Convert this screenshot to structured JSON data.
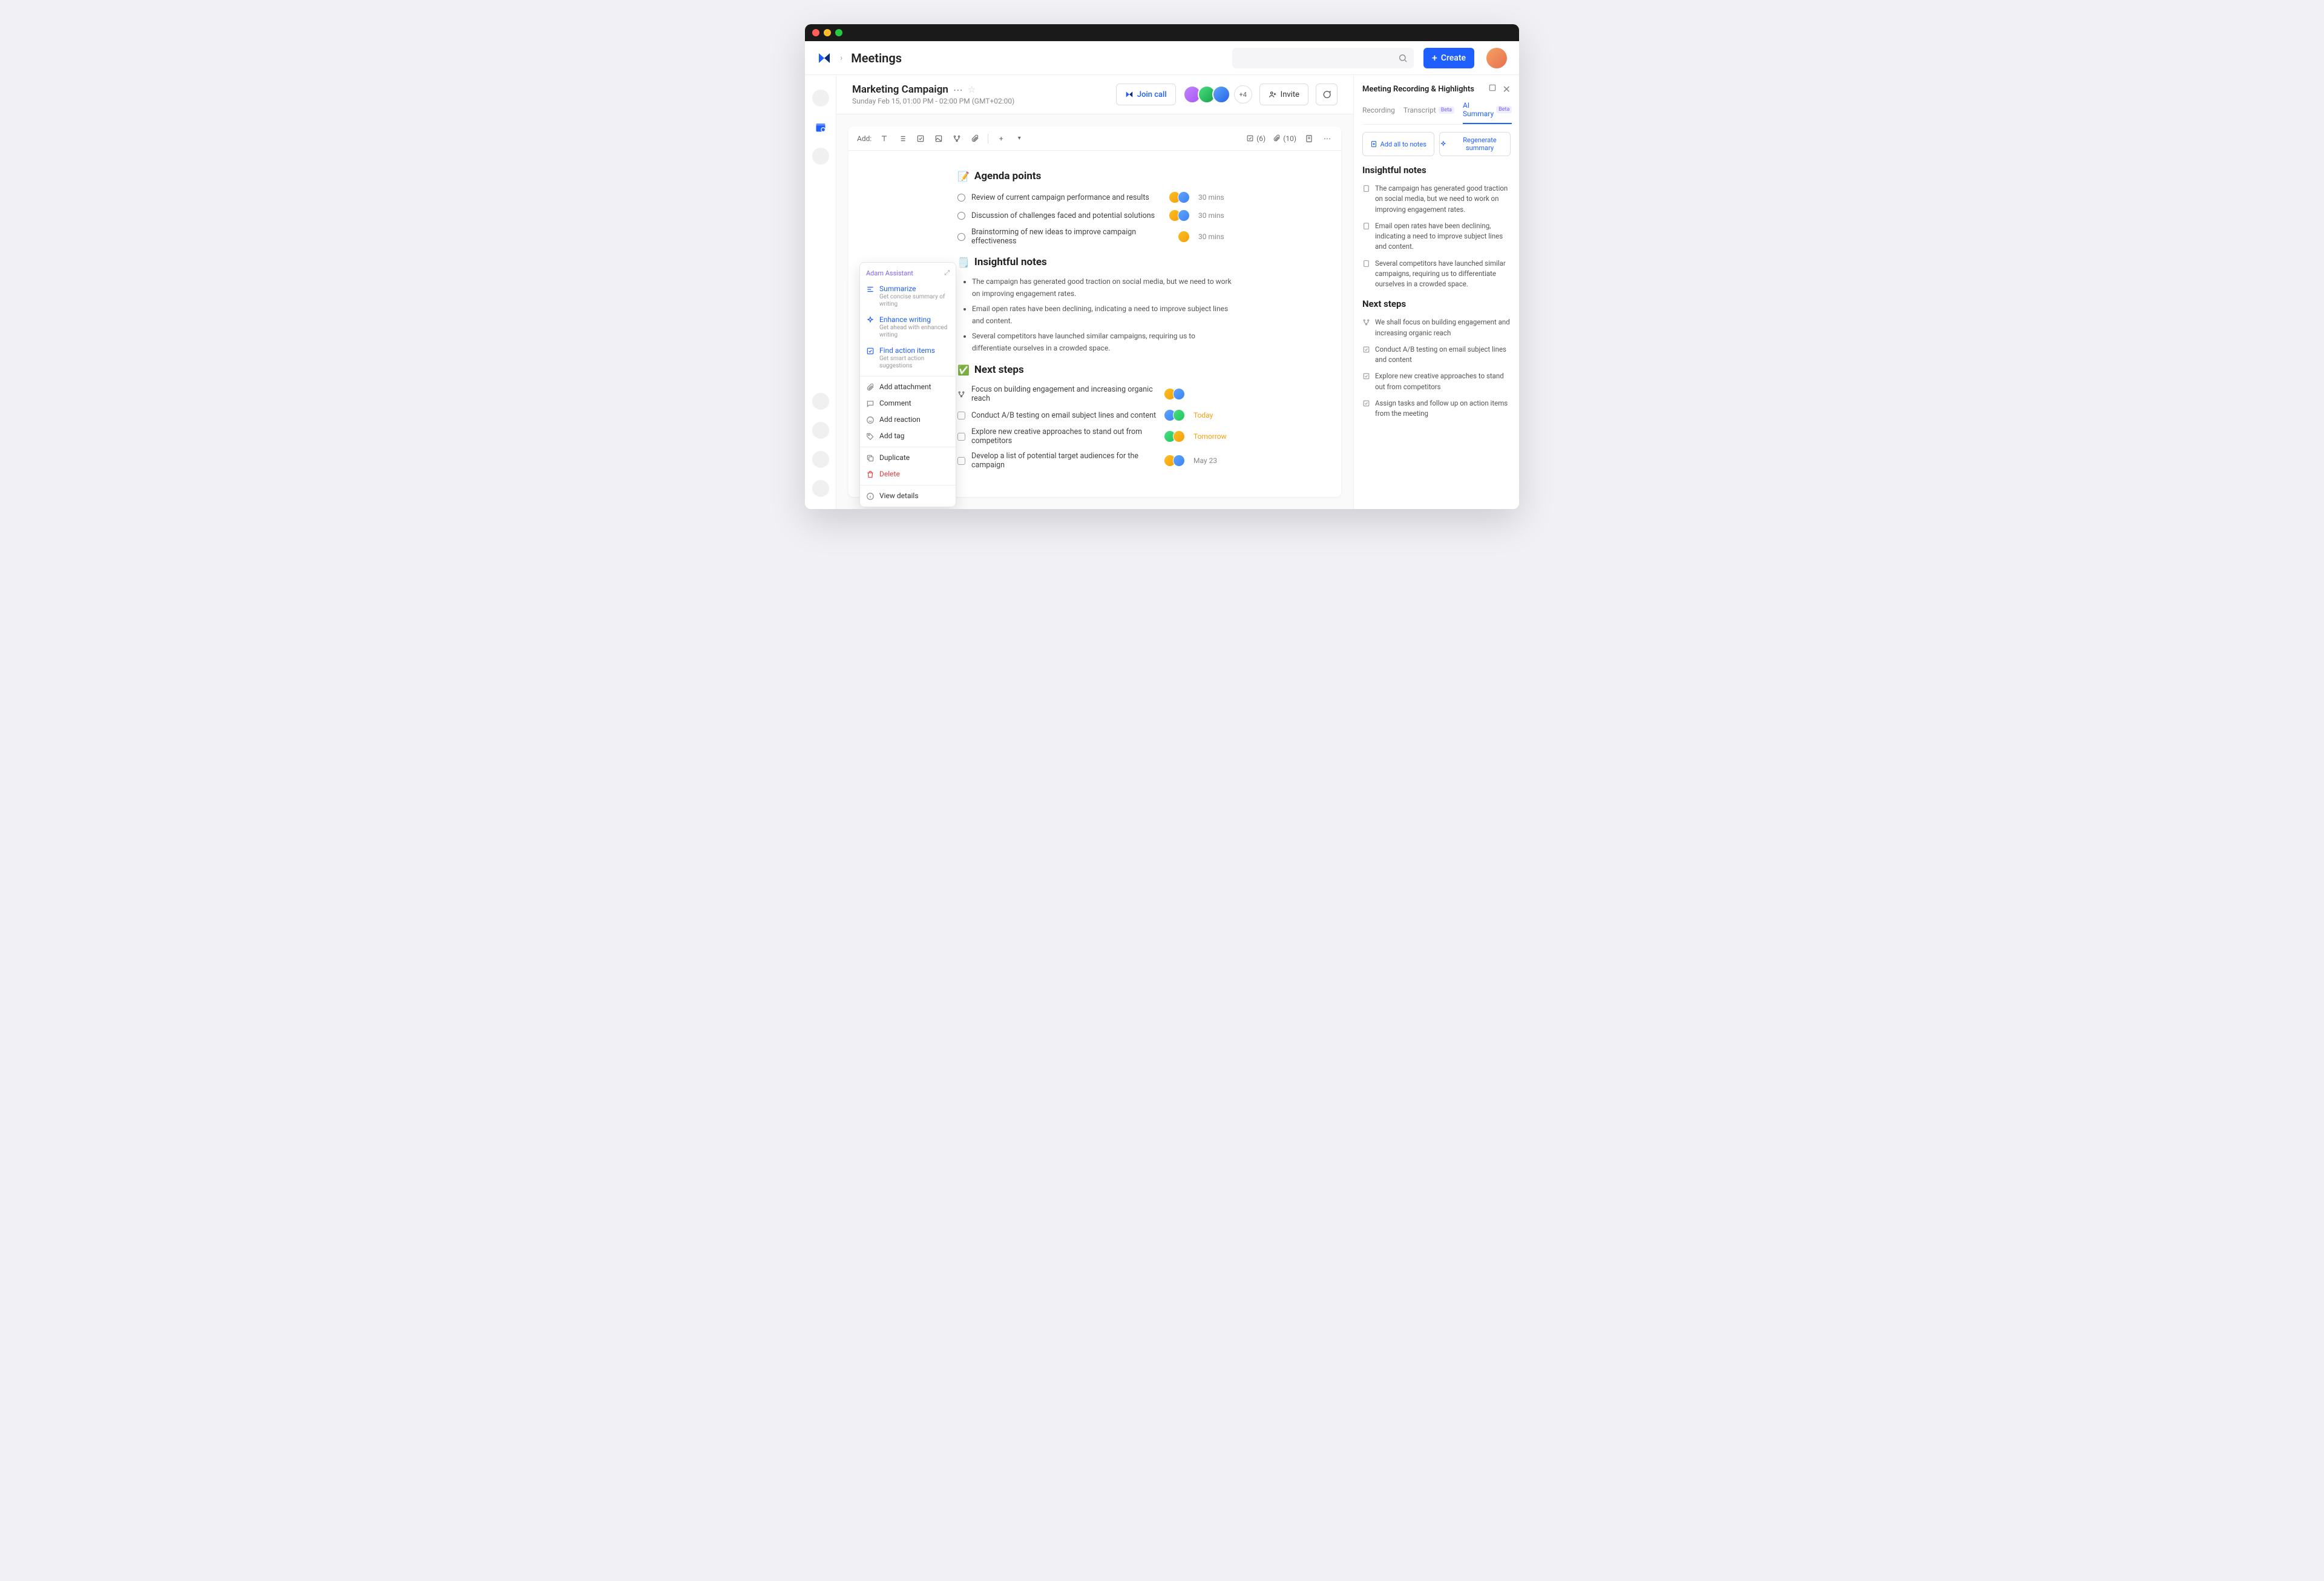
{
  "topbar": {
    "breadcrumb_title": "Meetings",
    "create_label": "Create"
  },
  "page": {
    "title": "Marketing Campaign",
    "subtitle": "Sunday Feb 15, 01:00 PM - 02:00 PM (GMT+02:00)",
    "join_call": "Join call",
    "invite": "Invite",
    "more_avatars": "+4"
  },
  "toolbar": {
    "add_label": "Add:",
    "check_count": "(6)",
    "attach_count": "(10)"
  },
  "sections": {
    "agenda_title": "Agenda points",
    "notes_title": "Insightful notes",
    "next_title": "Next steps"
  },
  "agenda": [
    {
      "text": "Review of current campaign performance and results",
      "duration": "30 mins"
    },
    {
      "text": "Discussion of challenges faced and potential solutions",
      "duration": "30 mins"
    },
    {
      "text": "Brainstorming of new ideas to improve campaign effectiveness",
      "duration": "30 mins"
    }
  ],
  "notes": [
    "The campaign has generated good traction on social media, but we need to work on improving engagement rates.",
    "Email open rates have been declining, indicating a need to improve subject lines and content.",
    "Several competitors have launched similar campaigns, requiring us to differentiate ourselves in a crowded space."
  ],
  "next_steps": [
    {
      "type": "branch",
      "text": "Focus on building engagement and increasing organic reach",
      "due": "",
      "due_class": ""
    },
    {
      "type": "check",
      "text": "Conduct A/B testing on email subject lines and content",
      "due": "Today",
      "due_class": "due-today"
    },
    {
      "type": "check",
      "text": "Explore new creative approaches to stand out from competitors",
      "due": "Tomorrow",
      "due_class": "due-tomorrow"
    },
    {
      "type": "check",
      "text": "Develop a list of potential target audiences for the campaign",
      "due": "May 23",
      "due_class": "due-date"
    }
  ],
  "context_menu": {
    "header": "Adam Assistant",
    "ai": [
      {
        "label": "Summarize",
        "sub": "Get concise summary of writing"
      },
      {
        "label": "Enhance writing",
        "sub": "Get ahead with enhanced writing"
      },
      {
        "label": "Find action items",
        "sub": "Get smart action suggestions"
      }
    ],
    "items": [
      {
        "label": "Add attachment",
        "icon": "paperclip"
      },
      {
        "label": "Comment",
        "icon": "comment"
      },
      {
        "label": "Add reaction",
        "icon": "smile"
      },
      {
        "label": "Add tag",
        "icon": "tag"
      }
    ],
    "items2": [
      {
        "label": "Duplicate",
        "icon": "copy"
      },
      {
        "label": "Delete",
        "icon": "trash",
        "red": true
      }
    ],
    "items3": [
      {
        "label": "View details",
        "icon": "info"
      }
    ]
  },
  "panel": {
    "title": "Meeting Recording & Highlights",
    "tabs": {
      "recording": "Recording",
      "transcript": "Transcript",
      "ai": "AI Summary",
      "beta": "Beta"
    },
    "add_all": "Add all to notes",
    "regenerate": "Regenerate summary",
    "h_notes": "Insightful notes",
    "h_next": "Next steps",
    "notes": [
      "The campaign has generated good traction on social media, but we need to work on improving engagement rates.",
      "Email open rates have been declining, indicating a need to improve subject lines and content.",
      "Several competitors have launched similar campaigns, requiring us to differentiate ourselves in a crowded space."
    ],
    "next": [
      {
        "icon": "branch",
        "text": "We shall focus on building engagement and increasing organic reach"
      },
      {
        "icon": "check",
        "text": "Conduct A/B testing on email subject lines and content"
      },
      {
        "icon": "check",
        "text": "Explore new creative approaches to stand out from competitors"
      },
      {
        "icon": "check",
        "text": "Assign tasks and follow up on action items from the meeting"
      }
    ]
  }
}
